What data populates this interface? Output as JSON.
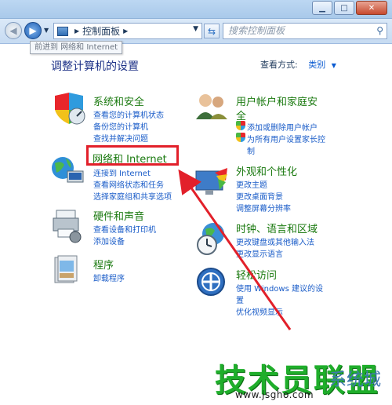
{
  "nav": {
    "address_root": "控制面板",
    "search_placeholder": "搜索控制面板",
    "tooltip": "前进到 网络和 Internet"
  },
  "page": {
    "heading": "调整计算机的设置",
    "view_by_label": "查看方式:",
    "view_by_value": "类别"
  },
  "categories": [
    {
      "title": "系统和安全",
      "links": [
        "查看您的计算机状态",
        "备份您的计算机",
        "查找并解决问题"
      ]
    },
    {
      "title": "网络和 Internet",
      "links": [
        "查看网络状态和任务",
        "选择家庭组和共享选项"
      ],
      "partial_link": "连接到 Internet"
    },
    {
      "title": "硬件和声音",
      "links": [
        "查看设备和打印机",
        "添加设备"
      ]
    },
    {
      "title": "程序",
      "links": [
        "卸载程序"
      ]
    },
    {
      "title_line1": "用户帐户和家庭安",
      "title_line2": "全",
      "links": [
        "添加或删除用户帐户",
        "为所有用户设置家长控",
        "制"
      ]
    },
    {
      "title": "外观和个性化",
      "links": [
        "更改主题",
        "更改桌面背景",
        "调整屏幕分辨率"
      ]
    },
    {
      "title": "时钟、语言和区域",
      "links": [
        "更改键盘或其他输入法",
        "更改显示语言"
      ]
    },
    {
      "title": "轻松访问",
      "links": [
        "使用 Windows 建议的设",
        "置",
        "优化视频显示"
      ]
    }
  ],
  "watermark": {
    "main": "技术员联盟",
    "url": "www.jsgho.com",
    "side": "系统城"
  },
  "colors": {
    "category_title": "#1b7a10",
    "link": "#1a5cc8",
    "highlight": "#e2202a",
    "watermark": "#1fae2b"
  }
}
